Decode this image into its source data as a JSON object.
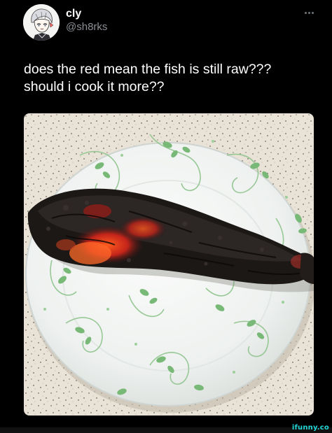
{
  "post": {
    "user": {
      "display_name": "cly",
      "handle": "@sh8rks"
    },
    "text": "does the red mean the fish is still raw??? should i cook it more??",
    "more_icon": "more-horizontal-icon"
  },
  "watermark": {
    "text": "ifunny.co",
    "color": "#22d6d6"
  },
  "colors": {
    "background": "#000000",
    "handle": "#8b8f94",
    "text": "#ffffff"
  }
}
